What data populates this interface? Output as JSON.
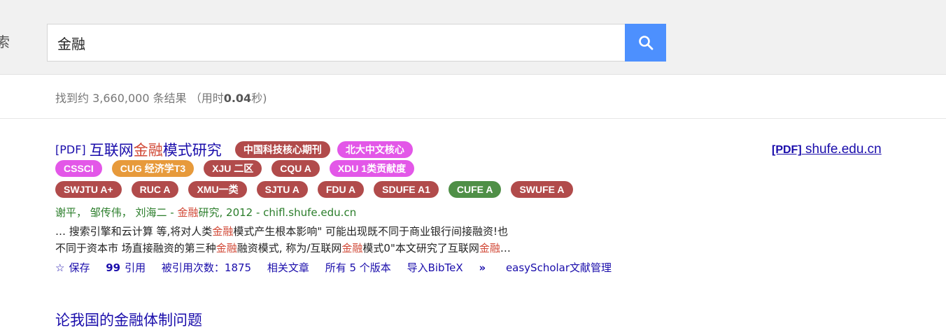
{
  "search": {
    "left_label": "索",
    "query": "金融",
    "button_icon": "search-icon"
  },
  "stats": {
    "prefix": "找到约 3,660,000 条结果 （用时",
    "time": "0.04",
    "suffix": "秒)"
  },
  "result1": {
    "prefix": "[PDF]",
    "title_a": "互联网",
    "title_hl": "金融",
    "title_b": "模式研究",
    "badges_line1": [
      {
        "label": "中国科技核心期刊",
        "color": "#b14b4b"
      },
      {
        "label": "北大中文核心",
        "color": "#e357e8"
      }
    ],
    "badges_line2": [
      {
        "label": "CSSCI",
        "color": "#e357e8"
      },
      {
        "label": "CUG 经济学T3",
        "color": "#e79a3b"
      },
      {
        "label": "XJU 二区",
        "color": "#b14b4b"
      },
      {
        "label": "CQU A",
        "color": "#b14b4b"
      },
      {
        "label": "XDU 1类贡献度",
        "color": "#e357e8"
      }
    ],
    "badges_line3": [
      {
        "label": "SWJTU A+",
        "color": "#b14b4b"
      },
      {
        "label": "RUC A",
        "color": "#b14b4b"
      },
      {
        "label": "XMU一类",
        "color": "#b14b4b"
      },
      {
        "label": "SJTU A",
        "color": "#b14b4b"
      },
      {
        "label": "FDU A",
        "color": "#b14b4b"
      },
      {
        "label": "SDUFE A1",
        "color": "#b14b4b"
      },
      {
        "label": "CUFE A",
        "color": "#4f8f47"
      },
      {
        "label": "SWUFE A",
        "color": "#b14b4b"
      }
    ],
    "authors_a": "谢平， 邹传伟， 刘海二 - ",
    "authors_hl": "金融",
    "authors_b": "研究, 2012 - chifl.shufe.edu.cn",
    "snippet_line1": "… 搜索引擎和云计算 等,将对人类金融模式产生根本影响\" 可能出现既不同于商业银行间接融资!也",
    "snippet_line2": "不同于资本市 场直接融资的第三种金融融资模式, 称为/互联网金融模式0\"本文研究了互联网金融…",
    "actions": {
      "save": "保存",
      "cite": "引用",
      "cited_by": "被引用次数：1875",
      "related": "相关文章",
      "versions": "所有 5 个版本",
      "bibtex": "导入BibTeX",
      "easyscholar": "easyScholar文献管理"
    },
    "side_prefix": "[PDF]",
    "side_domain": "shufe.edu.cn"
  },
  "result2": {
    "title_a": "论我国的",
    "title_hl": "金融",
    "title_b": "体制问题"
  }
}
